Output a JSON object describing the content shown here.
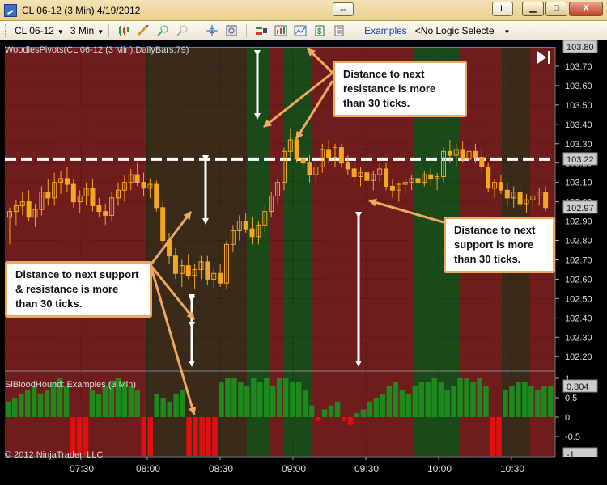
{
  "window": {
    "title": "CL 06-12 (3 Min)  4/19/2012",
    "resize_glyph": "⇔",
    "l_label": "L",
    "min_glyph": "▁",
    "max_glyph": "□",
    "close_glyph": "X"
  },
  "toolbar": {
    "instrument": "CL 06-12",
    "interval": "3 Min",
    "examples_label": "Examples",
    "logic_value": "<No Logic Selecte"
  },
  "panels": {
    "price_indicator_label": "WoodiesPivots(CL 06-12 (3 Min),DailyBars,79)",
    "lower_indicator_label": "SiBloodHound: Examples (3 Min)",
    "copyright": "© 2012 NinjaTrader, LLC"
  },
  "price_axis": {
    "ticks": [
      "103.70",
      "103.60",
      "103.50",
      "103.40",
      "103.30",
      "103.20",
      "103.10",
      "103.00",
      "102.90",
      "102.80",
      "102.70",
      "102.60",
      "102.50",
      "102.40",
      "102.30",
      "102.20"
    ],
    "top_badge": "103.80",
    "pivot_badge": "103.22",
    "last_badge": "102.97"
  },
  "lower_axis": {
    "ticks": [
      "1",
      "0.5",
      "0",
      "-0.5"
    ],
    "top_badge": "0.804",
    "bottom_badge": "-1"
  },
  "time_axis": {
    "labels": [
      "07:30",
      "08:00",
      "08:30",
      "09:00",
      "09:30",
      "10:00",
      "10:30"
    ]
  },
  "callouts": {
    "resistance": "Distance to next resistance is more than 30 ticks.",
    "support": "Distance to next support is more than 30 ticks.",
    "both": "Distance to next support & resistance is more than 30 ticks."
  },
  "colors": {
    "bg_red": "#6e1c1c",
    "bg_green": "#1a4a1a",
    "bg_brown": "#3a2a1a",
    "candle_up": "#f5a623",
    "candle_down": "#f5a623",
    "bar_green": "#1e8a1e",
    "bar_red": "#e01010",
    "callout_border": "#f0a860",
    "pivot_line": "#ffffff",
    "top_line": "#4a78d8"
  },
  "chart_data": {
    "type": "candlestick",
    "pivot_level": 103.22,
    "ylim": [
      102.13,
      103.8
    ],
    "candles": [
      [
        102.92,
        102.97,
        102.78,
        102.95
      ],
      [
        102.95,
        103.01,
        102.88,
        102.98
      ],
      [
        102.98,
        103.05,
        102.93,
        103.0
      ],
      [
        103.0,
        103.06,
        102.9,
        102.92
      ],
      [
        102.92,
        102.99,
        102.87,
        102.96
      ],
      [
        102.96,
        103.08,
        102.93,
        103.05
      ],
      [
        103.05,
        103.12,
        102.98,
        103.02
      ],
      [
        103.02,
        103.15,
        102.98,
        103.1
      ],
      [
        103.1,
        103.16,
        103.04,
        103.12
      ],
      [
        103.12,
        103.18,
        103.05,
        103.09
      ],
      [
        103.09,
        103.12,
        102.97,
        103.0
      ],
      [
        103.0,
        103.06,
        102.94,
        103.03
      ],
      [
        103.03,
        103.1,
        102.98,
        103.07
      ],
      [
        103.07,
        103.12,
        102.95,
        102.98
      ],
      [
        102.98,
        103.02,
        102.92,
        102.95
      ],
      [
        102.95,
        102.99,
        102.88,
        102.93
      ],
      [
        102.93,
        103.05,
        102.9,
        103.02
      ],
      [
        103.02,
        103.1,
        102.98,
        103.06
      ],
      [
        103.06,
        103.14,
        103.0,
        103.1
      ],
      [
        103.1,
        103.17,
        103.06,
        103.14
      ],
      [
        103.14,
        103.2,
        103.08,
        103.1
      ],
      [
        103.1,
        103.15,
        103.03,
        103.07
      ],
      [
        103.07,
        103.12,
        103.02,
        103.09
      ],
      [
        103.09,
        103.11,
        102.95,
        102.97
      ],
      [
        102.97,
        103.0,
        102.78,
        102.8
      ],
      [
        102.8,
        102.84,
        102.68,
        102.72
      ],
      [
        102.72,
        102.76,
        102.6,
        102.63
      ],
      [
        102.63,
        102.7,
        102.56,
        102.67
      ],
      [
        102.67,
        102.73,
        102.6,
        102.62
      ],
      [
        102.62,
        102.68,
        102.55,
        102.65
      ],
      [
        102.65,
        102.72,
        102.6,
        102.69
      ],
      [
        102.69,
        102.72,
        102.57,
        102.6
      ],
      [
        102.6,
        102.66,
        102.55,
        102.63
      ],
      [
        102.63,
        102.68,
        102.56,
        102.58
      ],
      [
        102.58,
        102.8,
        102.55,
        102.78
      ],
      [
        102.78,
        102.88,
        102.74,
        102.85
      ],
      [
        102.85,
        102.93,
        102.8,
        102.9
      ],
      [
        102.9,
        102.94,
        102.84,
        102.86
      ],
      [
        102.86,
        102.92,
        102.78,
        102.82
      ],
      [
        102.82,
        102.9,
        102.78,
        102.88
      ],
      [
        102.88,
        102.98,
        102.84,
        102.95
      ],
      [
        102.95,
        103.05,
        102.92,
        103.03
      ],
      [
        103.03,
        103.12,
        102.99,
        103.1
      ],
      [
        103.1,
        103.28,
        103.06,
        103.26
      ],
      [
        103.26,
        103.38,
        103.22,
        103.32
      ],
      [
        103.32,
        103.35,
        103.2,
        103.22
      ],
      [
        103.22,
        103.26,
        103.16,
        103.2
      ],
      [
        103.2,
        103.24,
        103.1,
        103.14
      ],
      [
        103.14,
        103.22,
        103.1,
        103.18
      ],
      [
        103.18,
        103.3,
        103.15,
        103.27
      ],
      [
        103.27,
        103.32,
        103.2,
        103.23
      ],
      [
        103.23,
        103.3,
        103.18,
        103.28
      ],
      [
        103.28,
        103.3,
        103.18,
        103.2
      ],
      [
        103.2,
        103.24,
        103.14,
        103.17
      ],
      [
        103.17,
        103.2,
        103.1,
        103.13
      ],
      [
        103.13,
        103.18,
        103.08,
        103.15
      ],
      [
        103.15,
        103.2,
        103.09,
        103.11
      ],
      [
        103.11,
        103.16,
        103.06,
        103.14
      ],
      [
        103.14,
        103.2,
        103.1,
        103.17
      ],
      [
        103.17,
        103.2,
        103.06,
        103.08
      ],
      [
        103.08,
        103.12,
        103.02,
        103.06
      ],
      [
        103.06,
        103.1,
        103.0,
        103.09
      ],
      [
        103.09,
        103.12,
        103.04,
        103.1
      ],
      [
        103.1,
        103.14,
        103.06,
        103.12
      ],
      [
        103.12,
        103.15,
        103.07,
        103.1
      ],
      [
        103.1,
        103.16,
        103.08,
        103.14
      ],
      [
        103.14,
        103.18,
        103.08,
        103.12
      ],
      [
        103.12,
        103.15,
        103.06,
        103.13
      ],
      [
        103.13,
        103.28,
        103.1,
        103.26
      ],
      [
        103.26,
        103.32,
        103.2,
        103.24
      ],
      [
        103.24,
        103.3,
        103.18,
        103.27
      ],
      [
        103.27,
        103.31,
        103.2,
        103.22
      ],
      [
        103.22,
        103.3,
        103.18,
        103.26
      ],
      [
        103.26,
        103.3,
        103.2,
        103.23
      ],
      [
        103.23,
        103.28,
        103.15,
        103.18
      ],
      [
        103.18,
        103.2,
        103.05,
        103.07
      ],
      [
        103.07,
        103.12,
        103.02,
        103.1
      ],
      [
        103.1,
        103.14,
        103.04,
        103.06
      ],
      [
        103.06,
        103.1,
        102.98,
        103.02
      ],
      [
        103.02,
        103.08,
        102.97,
        103.05
      ],
      [
        103.05,
        103.08,
        102.96,
        102.99
      ],
      [
        102.99,
        103.04,
        102.94,
        103.01
      ],
      [
        103.01,
        103.06,
        102.96,
        103.03
      ],
      [
        103.03,
        103.07,
        102.98,
        103.05
      ],
      [
        103.05,
        103.08,
        102.95,
        102.97
      ]
    ],
    "lower_values": [
      0.4,
      0.5,
      0.6,
      0.7,
      0.8,
      0.6,
      0.7,
      0.9,
      1.0,
      0.8,
      -1,
      -1,
      -1,
      0.7,
      0.6,
      0.8,
      0.9,
      1.0,
      0.9,
      0.8,
      0.7,
      -1,
      -1,
      0.6,
      0.5,
      0.4,
      0.6,
      0.7,
      -1,
      -1,
      -1,
      -1,
      -1,
      0.9,
      1.0,
      1.0,
      0.9,
      0.8,
      1.0,
      0.9,
      1.0,
      0.8,
      1.0,
      1.0,
      0.9,
      0.9,
      0.7,
      0.3,
      -0.1,
      0.2,
      0.3,
      0.4,
      -0.1,
      -0.2,
      0.1,
      0.2,
      0.4,
      0.5,
      0.6,
      0.8,
      0.9,
      0.7,
      0.6,
      0.8,
      0.9,
      0.9,
      1.0,
      0.9,
      0.7,
      0.8,
      1.0,
      1.0,
      0.9,
      1.0,
      0.8,
      -1,
      -1,
      0.7,
      0.8,
      0.9,
      0.9,
      0.8,
      0.7,
      0.8,
      0.8
    ]
  }
}
